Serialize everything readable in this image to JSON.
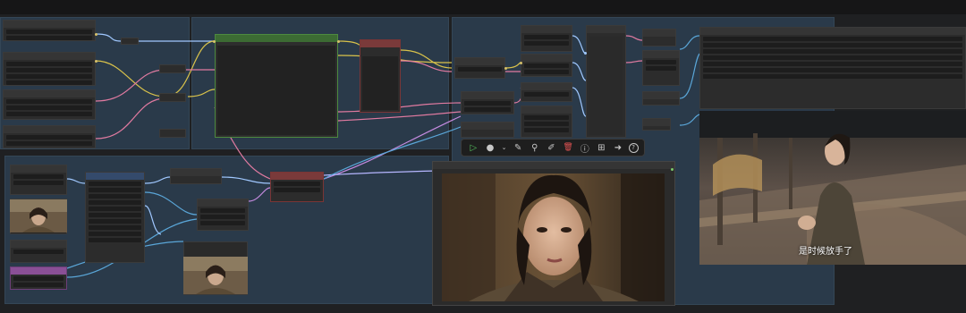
{
  "app": {
    "name": "ComfyUI workflow canvas"
  },
  "toolbar": {
    "buttons": [
      {
        "name": "run-button",
        "glyph": "▷"
      },
      {
        "name": "color-button",
        "glyph": "●"
      },
      {
        "name": "color-dropdown",
        "glyph": "⌄"
      },
      {
        "name": "bypass-button",
        "glyph": "✎"
      },
      {
        "name": "pin-button",
        "glyph": "⚲"
      },
      {
        "name": "edit-button",
        "glyph": "✐"
      },
      {
        "name": "delete-button",
        "glyph": "🗑"
      },
      {
        "name": "info-button",
        "glyph": "ⓘ"
      },
      {
        "name": "convert-group-button",
        "glyph": "⊞"
      },
      {
        "name": "goto-button",
        "glyph": "➜"
      },
      {
        "name": "help-button",
        "glyph": "?"
      }
    ]
  },
  "subtitle": {
    "text": "是时候放手了"
  },
  "colors": {
    "canvas": "#1f2022",
    "group": "#2a3a4a",
    "node_green": "#3c6b33",
    "node_red": "#7a3a3a",
    "node_purple": "#8a4f96",
    "wire_yellow": "#d9c24a",
    "wire_pink": "#e07aa0",
    "wire_blue": "#5aa6d8",
    "wire_violet": "#c58be0"
  }
}
